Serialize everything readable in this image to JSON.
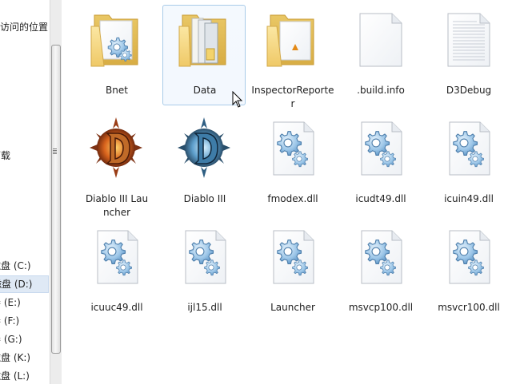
{
  "nav": {
    "items": [
      {
        "label": "访问的位置"
      },
      {
        "label": "下载"
      },
      {
        "label": "磁盘 (C:)"
      },
      {
        "label": "磁盘 (D:)"
      },
      {
        "label": "卷 (E:)"
      },
      {
        "label": "卷 (F:)"
      },
      {
        "label": "卷 (G:)"
      },
      {
        "label": "磁盘 (K:)"
      },
      {
        "label": "磁盘 (L:)"
      }
    ]
  },
  "files": [
    {
      "name": "Bnet",
      "icon": "folder-icon"
    },
    {
      "name": "Data",
      "icon": "folder-icon"
    },
    {
      "name": "InspectorReporter",
      "icon": "folder-icon"
    },
    {
      "name": ".build.info",
      "icon": "blank-file-icon"
    },
    {
      "name": "D3Debug",
      "icon": "text-file-icon"
    },
    {
      "name": "Diablo III Launcher",
      "icon": "diablo-launcher-icon"
    },
    {
      "name": "Diablo III",
      "icon": "diablo-game-icon"
    },
    {
      "name": "fmodex.dll",
      "icon": "dll-gear-icon"
    },
    {
      "name": "icudt49.dll",
      "icon": "dll-gear-icon"
    },
    {
      "name": "icuin49.dll",
      "icon": "dll-gear-icon"
    },
    {
      "name": "icuuc49.dll",
      "icon": "dll-gear-icon"
    },
    {
      "name": "ijl15.dll",
      "icon": "dll-gear-icon"
    },
    {
      "name": "Launcher",
      "icon": "dll-gear-icon"
    },
    {
      "name": "msvcp100.dll",
      "icon": "dll-gear-icon"
    },
    {
      "name": "msvcr100.dll",
      "icon": "dll-gear-icon"
    }
  ],
  "colors": {
    "folder": "#f2d67c",
    "hover_border": "#a9cbe9",
    "gear": "#7fb0da",
    "diablo_launcher_red": "#c2431a",
    "diablo_game_blue": "#3e7ca8"
  }
}
